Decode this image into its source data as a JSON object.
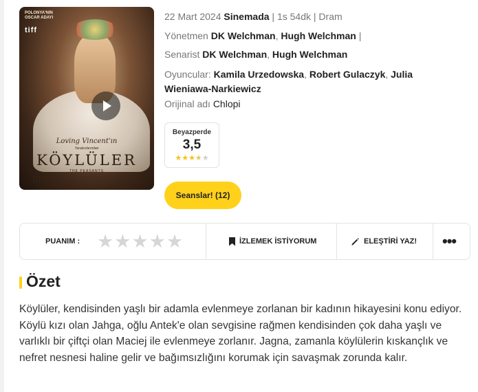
{
  "movie": {
    "poster": {
      "badge": "POLONYA'NIN\nOSCAR ADAYI",
      "festival": "tiff",
      "tagline": "Loving Vincent'ın",
      "tagline_sub": "Yaratıcılarından",
      "title": "KÖYLÜLER",
      "subtitle": "THE PEASANTS",
      "play_icon": "play-icon"
    },
    "date": "22 Mart 2024",
    "status": "Sinemada",
    "duration": "1s 54dk",
    "genre": "Dram",
    "director_label": "Yönetmen",
    "directors": [
      "DK Welchman",
      "Hugh Welchman"
    ],
    "writer_label": "Senarist",
    "writers": [
      "DK Welchman",
      "Hugh Welchman"
    ],
    "cast_label": "Oyuncular:",
    "cast": [
      "Kamila Urzedowska",
      "Robert Gulaczyk",
      "Julia Wieniawa-Narkiewicz"
    ],
    "original_label": "Orijinal adı",
    "original_title": "Chlopi"
  },
  "rating": {
    "source": "Beyazperde",
    "score": "3,5",
    "stars_filled": 3.5,
    "stars_total": 5
  },
  "sessions_button": "Seanslar! (12)",
  "actions": {
    "rate_label": "PUANIM :",
    "user_stars_total": 5,
    "watchlist_label": "İZLEMEK İSTİYORUM",
    "review_label": "ELEŞTİRİ YAZ!",
    "more_label": "•••"
  },
  "summary": {
    "heading": "Özet",
    "text": "Köylüler, kendisinden yaşlı bir adamla evlenmeye zorlanan bir kadının hikayesini konu ediyor. Köylü kızı olan Jahga, oğlu Antek'e olan sevgisine rağmen kendisinden çok daha yaşlı ve varlıklı bir çiftçi olan Maciej ile evlenmeye zorlanır. Jagna, zamanla köylülerin kıskançlık ve nefret nesnesi haline gelir ve bağımsızlığını korumak için savaşmak zorunda kalır."
  },
  "colors": {
    "accent": "#ffd11a",
    "star_filled": "#f5c21b",
    "star_empty": "#d6d6d6"
  }
}
